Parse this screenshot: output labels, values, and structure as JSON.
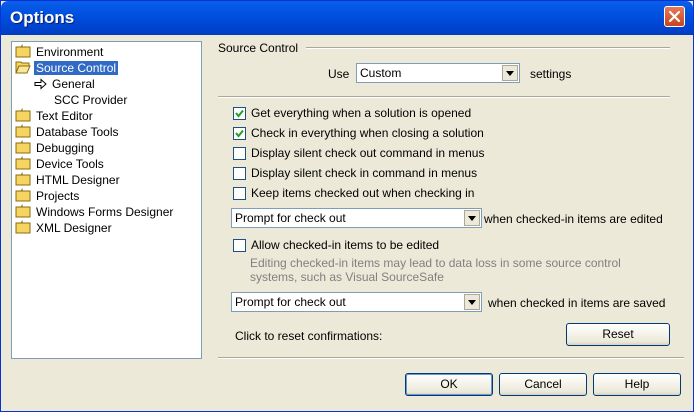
{
  "window": {
    "title": "Options"
  },
  "tree": {
    "items": [
      {
        "label": "Environment",
        "icon": "folder-icon"
      },
      {
        "label": "Source Control",
        "icon": "folder-open-icon",
        "selected": true
      },
      {
        "label": "General",
        "icon": "arrow-icon"
      },
      {
        "label": "SCC Provider"
      },
      {
        "label": "Text Editor",
        "icon": "folder-icon"
      },
      {
        "label": "Database Tools",
        "icon": "folder-icon"
      },
      {
        "label": "Debugging",
        "icon": "folder-icon"
      },
      {
        "label": "Device Tools",
        "icon": "folder-icon"
      },
      {
        "label": "HTML Designer",
        "icon": "folder-icon"
      },
      {
        "label": "Projects",
        "icon": "folder-icon"
      },
      {
        "label": "Windows Forms Designer",
        "icon": "folder-icon"
      },
      {
        "label": "XML Designer",
        "icon": "folder-icon"
      }
    ]
  },
  "panel": {
    "group_title": "Source Control",
    "use_label": "Use",
    "settings_combo": "Custom",
    "settings_label": "settings",
    "checkboxes": [
      {
        "label": "Get everything when a solution is opened",
        "checked": true
      },
      {
        "label": "Check in everything when closing a solution",
        "checked": true
      },
      {
        "label": "Display silent check out command in menus",
        "checked": false
      },
      {
        "label": "Display silent check in command in menus",
        "checked": false
      },
      {
        "label": "Keep items checked out when checking in",
        "checked": false
      }
    ],
    "edit_combo": "Prompt for check out",
    "edit_label": "when checked-in items are edited",
    "allow_edit": {
      "label": "Allow checked-in items to be edited",
      "checked": false
    },
    "allow_edit_note": "Editing checked-in items may lead to data loss in some source control systems, such as Visual SourceSafe",
    "save_combo": "Prompt for check out",
    "save_label": "when checked in items are saved",
    "reset_text": "Click to reset confirmations:",
    "reset_button": "Reset"
  },
  "buttons": {
    "ok": "OK",
    "cancel": "Cancel",
    "help": "Help"
  },
  "colors": {
    "title_bar": "#0054e3",
    "selection": "#316ac5",
    "close_button": "#d9552f",
    "dialog_bg": "#ece9d8"
  }
}
